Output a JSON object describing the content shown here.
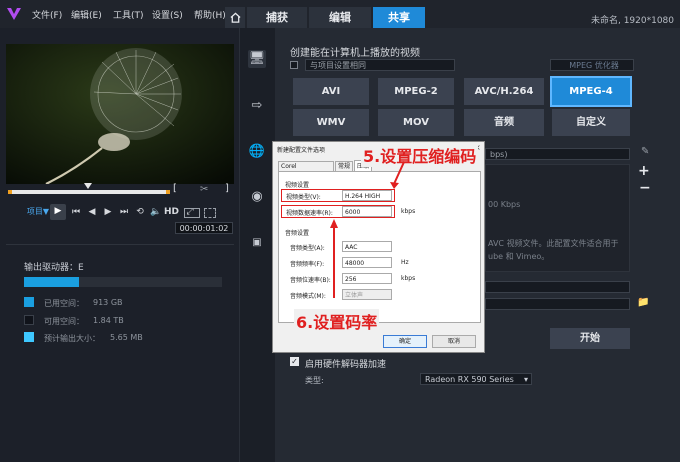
{
  "menubar": {
    "menus": [
      "文件(F)",
      "编辑(E)",
      "工具(T)",
      "设置(S)",
      "帮助(H)"
    ],
    "tabs": [
      "捕获",
      "编辑",
      "共享"
    ],
    "project_info": "未命名, 1920*1080"
  },
  "player": {
    "project_label": "项目▼",
    "hd_label": "HD",
    "timecode": "00:00:01:02"
  },
  "output": {
    "drive_label": "输出驱动器：E",
    "used_label": "已用空间：",
    "used_value": "913 GB",
    "free_label": "可用空间：",
    "free_value": "1.84 TB",
    "est_label": "预计输出大小：",
    "est_value": "5.65 MB",
    "colors": {
      "used": "#1a9fe0",
      "free": "#2a2f38",
      "est": "#3ec8ff"
    }
  },
  "share": {
    "heading": "创建能在计算机上播放的视频",
    "device_checkbox_label": "与项目设置相同",
    "mpeg_optimizer": "MPEG 优化器",
    "formats_row1": [
      "AVI",
      "MPEG-2",
      "AVC/H.264",
      "MPEG-4"
    ],
    "formats_row2": [
      "WMV",
      "MOV",
      "音频",
      "自定义"
    ],
    "selected_format": "MPEG-4",
    "profile_suffix": "bps)",
    "desc_bitrate": "00 Kbps",
    "desc_line1": "AVC 视频文件。此配置文件适合用于",
    "desc_line2": "ube 和 Vimeo。",
    "start_button": "开始",
    "hw_accel_label": "启用硬件解码器加速",
    "type_label": "类型:",
    "type_value": "Radeon RX 590 Series"
  },
  "dialog": {
    "title": "新建配置文件选项",
    "tabs": [
      "Corel VideoStudio",
      "常规",
      "压缩"
    ],
    "video_section": "视频设置",
    "video_type_label": "视频类型(V):",
    "video_type_value": "H.264 HIGH",
    "video_rate_label": "视频数据速率(R):",
    "video_rate_value": "6000",
    "video_rate_unit": "kbps",
    "audio_section": "音频设置",
    "audio_type_label": "音频类型(A):",
    "audio_type_value": "AAC",
    "audio_freq_label": "音频频率(F):",
    "audio_freq_value": "48000",
    "audio_freq_unit": "Hz",
    "audio_bitrate_label": "音频位速率(B):",
    "audio_bitrate_value": "256",
    "audio_bitrate_unit": "kbps",
    "audio_mode_label": "音频模式(M):",
    "audio_mode_value": "立体声",
    "ok_button": "确定",
    "cancel_button": "取消"
  },
  "annotations": {
    "step5": "5.设置压缩编码",
    "step6": "6.设置码率"
  }
}
